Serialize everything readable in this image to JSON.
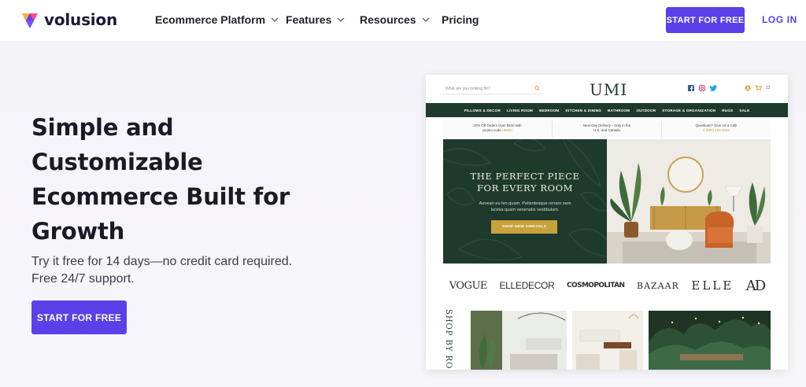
{
  "brand": {
    "name": "volusion"
  },
  "nav": {
    "items": [
      {
        "label": "Ecommerce Platform",
        "has_dropdown": true
      },
      {
        "label": "Features",
        "has_dropdown": true
      },
      {
        "label": "Resources",
        "has_dropdown": true
      },
      {
        "label": "Pricing",
        "has_dropdown": false
      }
    ],
    "start_label": "START FOR FREE",
    "login_label": "LOG IN"
  },
  "hero": {
    "title_lines": [
      "Simple and",
      "Customizable",
      "Ecommerce Built for",
      "Growth"
    ],
    "subtitle_lines": [
      "Try it free for 14 days—no credit card required.",
      "Free 24/7 support."
    ],
    "cta_label": "START FOR FREE"
  },
  "preview": {
    "search_placeholder": "What are you looking for?",
    "logo": "UMI",
    "cart_count": "12",
    "categories": [
      "PILLOWS & DECOR",
      "LIVING ROOM",
      "BEDROOM",
      "KITCHEN & DINING",
      "BATHROOM",
      "OUTDOOR",
      "STORAGE & ORGANIZATION",
      "RUGS",
      "SALE"
    ],
    "promos": [
      {
        "line1": "20% Off Orders Over $100 with",
        "line2_prefix": "promo code ",
        "highlight": "UMI20"
      },
      {
        "line1": "Next Day Delivery - Only in the",
        "line2_prefix": "U.S. and Canada",
        "highlight": ""
      },
      {
        "line1": "Questions? Give Us a Call!",
        "line2_prefix": "",
        "highlight": "1 (800) 123-4444"
      }
    ],
    "banner": {
      "headline_lines": [
        "THE PERFECT PIECE",
        "FOR EVERY ROOM"
      ],
      "desc_lines": [
        "Aenean eu leo quam. Pellentesque ornare sem",
        "lacinia quam venenatis vestibulum."
      ],
      "cta": "SHOP NEW ARRIVALS"
    },
    "press": [
      "VOGUE",
      "ELLEDECOR",
      "COSMOPOLITAN",
      "BAZAAR",
      "ELLE",
      "AD"
    ],
    "shop_by": "SHOP BY ROOM"
  },
  "colors": {
    "accent": "#5b3fe8",
    "umi_green": "#1e3a2c",
    "umi_gold": "#c8a23a",
    "hero_bg": "#f4f3f8"
  }
}
